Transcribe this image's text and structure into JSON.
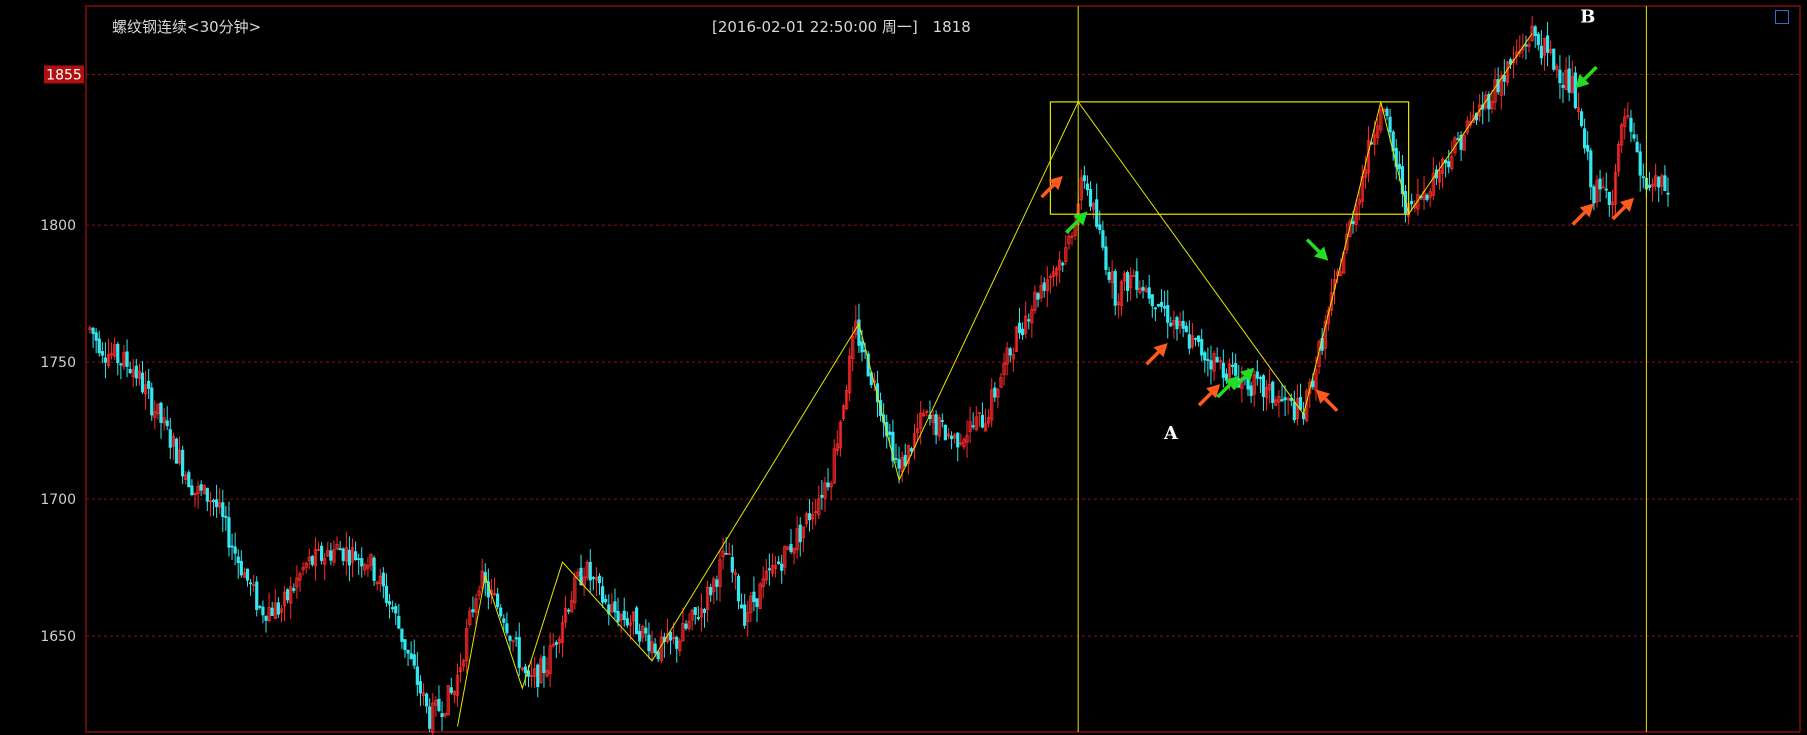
{
  "header": {
    "title": "螺纹钢连续<30分钟>",
    "datetime_info": "[2016-02-01  22:50:00 周一]",
    "current_value": "1818"
  },
  "colors": {
    "up": "#ff2a2a",
    "down": "#33e8f0",
    "background": "#000000",
    "frame": "#a01010",
    "grid": "#8a1010",
    "annotation": "#e6e600",
    "arrow_orange": "#ff5a1e",
    "arrow_green": "#22dd22",
    "price_marker_bg": "#b01010"
  },
  "chart_data": {
    "type": "candlestick",
    "title": "螺纹钢连续<30分钟>",
    "ylim": [
      1615,
      1880
    ],
    "y_ticks": [
      1650,
      1700,
      1750,
      1800
    ],
    "highlighted_price": 1855,
    "grid": "horizontal-dashed",
    "bar_count": 380,
    "price_path_keypoints": [
      {
        "i": 0,
        "v": 1762
      },
      {
        "i": 5,
        "v": 1754
      },
      {
        "i": 14,
        "v": 1748
      },
      {
        "i": 26,
        "v": 1722
      },
      {
        "i": 34,
        "v": 1703
      },
      {
        "i": 40,
        "v": 1700
      },
      {
        "i": 48,
        "v": 1678
      },
      {
        "i": 55,
        "v": 1660
      },
      {
        "i": 62,
        "v": 1660
      },
      {
        "i": 70,
        "v": 1676
      },
      {
        "i": 80,
        "v": 1682
      },
      {
        "i": 90,
        "v": 1678
      },
      {
        "i": 98,
        "v": 1660
      },
      {
        "i": 104,
        "v": 1640
      },
      {
        "i": 110,
        "v": 1620
      },
      {
        "i": 118,
        "v": 1630
      },
      {
        "i": 126,
        "v": 1671
      },
      {
        "i": 134,
        "v": 1658
      },
      {
        "i": 142,
        "v": 1632
      },
      {
        "i": 148,
        "v": 1640
      },
      {
        "i": 154,
        "v": 1660
      },
      {
        "i": 160,
        "v": 1675
      },
      {
        "i": 168,
        "v": 1660
      },
      {
        "i": 176,
        "v": 1655
      },
      {
        "i": 184,
        "v": 1645
      },
      {
        "i": 190,
        "v": 1648
      },
      {
        "i": 198,
        "v": 1660
      },
      {
        "i": 206,
        "v": 1680
      },
      {
        "i": 212,
        "v": 1658
      },
      {
        "i": 220,
        "v": 1672
      },
      {
        "i": 230,
        "v": 1688
      },
      {
        "i": 240,
        "v": 1710
      },
      {
        "i": 248,
        "v": 1762
      },
      {
        "i": 256,
        "v": 1735
      },
      {
        "i": 262,
        "v": 1710
      },
      {
        "i": 270,
        "v": 1730
      },
      {
        "i": 280,
        "v": 1722
      },
      {
        "i": 290,
        "v": 1730
      },
      {
        "i": 300,
        "v": 1760
      },
      {
        "i": 308,
        "v": 1778
      },
      {
        "i": 316,
        "v": 1790
      },
      {
        "i": 322,
        "v": 1818
      },
      {
        "i": 326,
        "v": 1800
      },
      {
        "i": 332,
        "v": 1775
      },
      {
        "i": 338,
        "v": 1782
      },
      {
        "i": 346,
        "v": 1772
      },
      {
        "i": 354,
        "v": 1760
      },
      {
        "i": 362,
        "v": 1752
      },
      {
        "i": 370,
        "v": 1746
      },
      {
        "i": 379,
        "v": 1740
      }
    ],
    "zigzag": [
      {
        "i": 119,
        "v": 1617
      },
      {
        "i": 128,
        "v": 1672
      },
      {
        "i": 140,
        "v": 1631
      },
      {
        "i": 153,
        "v": 1677
      },
      {
        "i": 182,
        "v": 1641
      },
      {
        "i": 249,
        "v": 1764
      },
      {
        "i": 262,
        "v": 1707
      },
      {
        "i": 320,
        "v": 1845
      },
      {
        "i": 393,
        "v": 1731
      },
      {
        "i": 418,
        "v": 1845
      },
      {
        "i": 427,
        "v": 1804
      },
      {
        "i": 467,
        "v": 1870
      }
    ],
    "box": {
      "i_start": 311,
      "i_end": 427,
      "v_top": 1845,
      "v_bottom": 1804
    },
    "vertical_lines_index": [
      320,
      504
    ],
    "annotations": [
      {
        "label": "A",
        "i": 350,
        "v": 1722
      },
      {
        "label": "B",
        "i": 485,
        "v": 1874
      }
    ],
    "arrows": [
      {
        "color": "orange",
        "i": 315,
        "v": 1818,
        "dir": "up-right"
      },
      {
        "color": "green",
        "i": 323,
        "v": 1805,
        "dir": "up-right"
      },
      {
        "color": "orange",
        "i": 349,
        "v": 1757,
        "dir": "up-right"
      },
      {
        "color": "orange",
        "i": 366,
        "v": 1742,
        "dir": "up-right"
      },
      {
        "color": "green",
        "i": 372,
        "v": 1745,
        "dir": "up-right"
      },
      {
        "color": "green",
        "i": 377,
        "v": 1748,
        "dir": "up-right"
      },
      {
        "color": "orange",
        "i": 397,
        "v": 1740,
        "dir": "up-left"
      },
      {
        "color": "green",
        "i": 401,
        "v": 1787,
        "dir": "down-right"
      },
      {
        "color": "green",
        "i": 481,
        "v": 1850,
        "dir": "down-left"
      },
      {
        "color": "orange",
        "i": 487,
        "v": 1808,
        "dir": "up-right"
      },
      {
        "color": "orange",
        "i": 500,
        "v": 1810,
        "dir": "up-right"
      }
    ]
  }
}
